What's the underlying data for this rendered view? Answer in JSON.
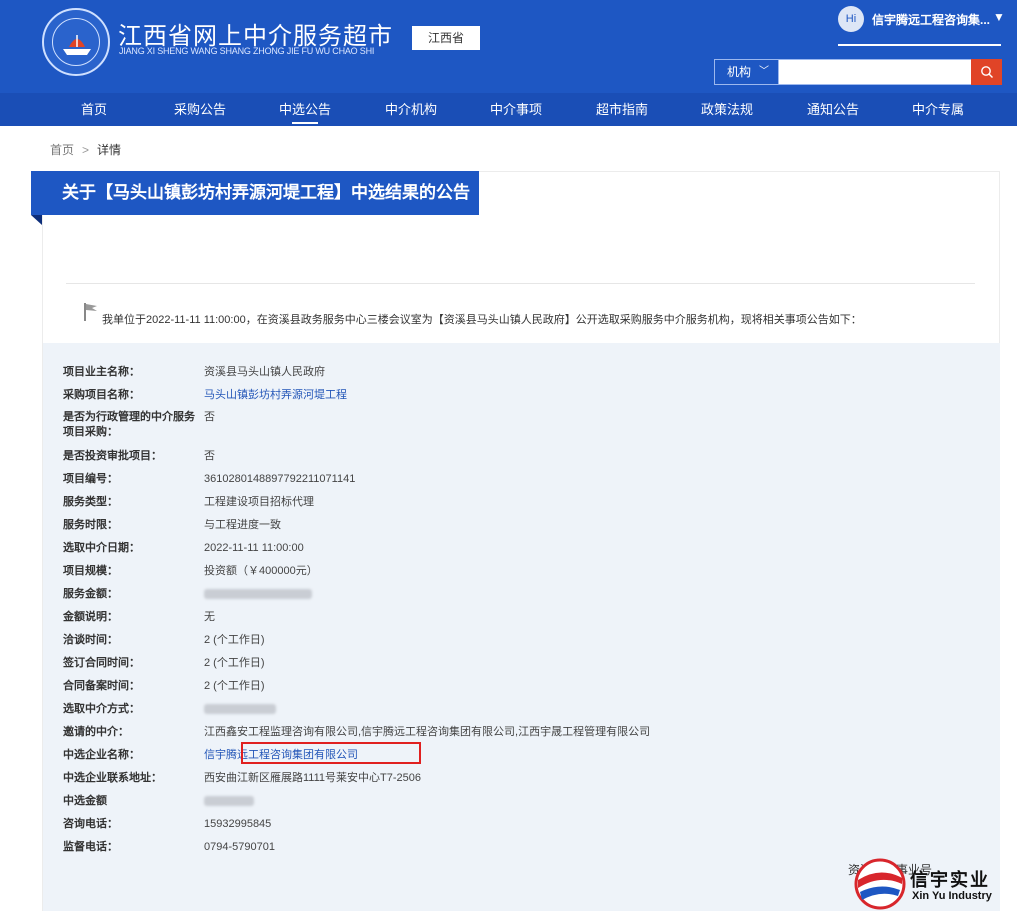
{
  "header": {
    "site_title": "江西省网上中介服务超市",
    "site_subtitle": "JIANG XI SHENG WANG SHANG ZHONG JIE FU WU CHAO SHI",
    "region": "江西省",
    "user_hi": "Hi",
    "user_name": "信宇腾远工程咨询集...",
    "user_caret": "▼",
    "search_type": "机构",
    "search_chevron": "﹀",
    "search_placeholder": ""
  },
  "nav": {
    "items": [
      "首页",
      "采购公告",
      "中选公告",
      "中介机构",
      "中介事项",
      "超市指南",
      "政策法规",
      "通知公告",
      "中介专属"
    ],
    "active_index": 2
  },
  "breadcrumb": {
    "home": "首页",
    "sep": ">",
    "current": "详情"
  },
  "notice": {
    "title": "关于【马头山镇彭坊村弄源河堤工程】中选结果的公告",
    "intro": "我单位于2022-11-11 11:00:00，在资溪县政务服务中心三楼会议室为【资溪县马头山镇人民政府】公开选取采购服务中介服务机构，现将相关事项公告如下："
  },
  "details": [
    {
      "label": "项目业主名称：",
      "value": "资溪县马头山镇人民政府"
    },
    {
      "label": "采购项目名称：",
      "value": "马头山镇彭坊村弄源河堤工程"
    },
    {
      "label": "是否为行政管理的中介服务项目采购：",
      "value": "否"
    },
    {
      "label": "是否投资审批项目：",
      "value": "否"
    },
    {
      "label": "项目编号：",
      "value": "3610280148897792211071141"
    },
    {
      "label": "服务类型：",
      "value": "工程建设项目招标代理"
    },
    {
      "label": "服务时限：",
      "value": "与工程进度一致"
    },
    {
      "label": "选取中介日期：",
      "value": "2022-11-11 11:00:00"
    },
    {
      "label": "项目规模：",
      "value": "投资额（￥400000元）"
    },
    {
      "label": "服务金额：",
      "value": ""
    },
    {
      "label": "金额说明：",
      "value": "无"
    },
    {
      "label": "洽谈时间：",
      "value": "2 (个工作日)"
    },
    {
      "label": "签订合同时间：",
      "value": "2 (个工作日)"
    },
    {
      "label": "合同备案时间：",
      "value": "2 (个工作日)"
    },
    {
      "label": "选取中介方式：",
      "value": ""
    },
    {
      "label": "邀请的中介：",
      "value": "江西鑫安工程监理咨询有限公司,信宇腾远工程咨询集团有限公司,江西宇晟工程管理有限公司"
    },
    {
      "label": "中选企业名称：",
      "value": "信宇腾远工程咨询集团有限公司"
    },
    {
      "label": "中选企业联系地址：",
      "value": "西安曲江新区雁展路1111号莱安中心T7-2506"
    },
    {
      "label": "中选金额",
      "value": ""
    },
    {
      "label": "咨询电话：",
      "value": "15932995845"
    },
    {
      "label": "监督电话：",
      "value": "0794-5790701"
    }
  ],
  "footer_partial": "资溪县…事业号",
  "watermark": {
    "cn": "信宇实业",
    "en": "Xin Yu Industry"
  },
  "colors": {
    "primary": "#1e57c3",
    "nav": "#1a4eb6",
    "accent": "#e04427",
    "highlight": "#e02020"
  }
}
